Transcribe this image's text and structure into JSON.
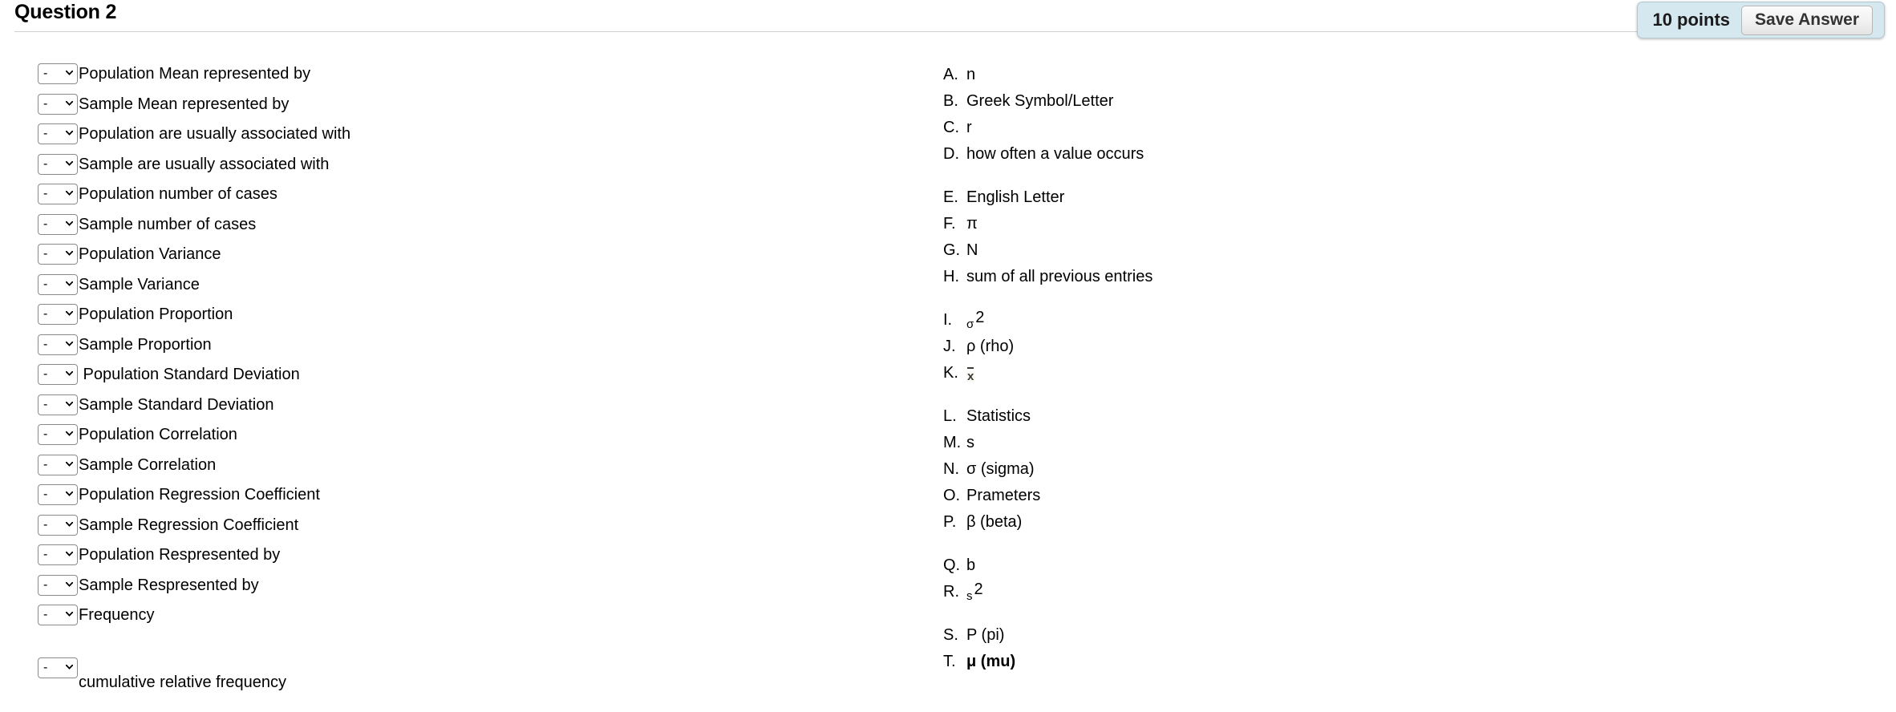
{
  "header": {
    "title": "Question 2",
    "points_label": "10 points",
    "save_label": "Save Answer"
  },
  "select": {
    "current_value": "-",
    "options": [
      "-",
      "A",
      "B",
      "C",
      "D",
      "E",
      "F",
      "G",
      "H",
      "I",
      "J",
      "K",
      "L",
      "M",
      "N",
      "O",
      "P",
      "Q",
      "R",
      "S",
      "T"
    ]
  },
  "prompts": [
    {
      "label": "Population Mean represented by"
    },
    {
      "label": "Sample Mean represented by"
    },
    {
      "label": "Population are usually associated with"
    },
    {
      "label": "Sample are usually associated with"
    },
    {
      "label": "Population number of cases"
    },
    {
      "label": "Sample number of cases"
    },
    {
      "label": "Population Variance"
    },
    {
      "label": "Sample Variance"
    },
    {
      "label": "Population Proportion"
    },
    {
      "label": "Sample Proportion"
    },
    {
      "label": " Population Standard Deviation"
    },
    {
      "label": "Sample Standard Deviation"
    },
    {
      "label": "Population Correlation"
    },
    {
      "label": "Sample Correlation"
    },
    {
      "label": "Population Regression Coefficient"
    },
    {
      "label": "Sample Regression Coefficient"
    },
    {
      "label": "Population Respresented by"
    },
    {
      "label": "Sample Respresented by"
    },
    {
      "label": "Frequency"
    }
  ],
  "prompt_last": {
    "label": "cumulative relative frequency"
  },
  "options": [
    {
      "letter": "A.",
      "text": "n"
    },
    {
      "letter": "B.",
      "text": "Greek Symbol/Letter"
    },
    {
      "letter": "C.",
      "text": "r"
    },
    {
      "letter": "D.",
      "text": "how often a value occurs"
    },
    {
      "letter": "E.",
      "text": "English Letter"
    },
    {
      "letter": "F.",
      "text": "π"
    },
    {
      "letter": "G.",
      "text": "N"
    },
    {
      "letter": "H.",
      "text": "sum of all previous entries"
    },
    {
      "letter": "I.",
      "text": "σ 2",
      "base": "σ",
      "exponent": "2"
    },
    {
      "letter": "J.",
      "text": "ρ (rho)"
    },
    {
      "letter": "K.",
      "text": "x̄"
    },
    {
      "letter": "L.",
      "text": "Statistics"
    },
    {
      "letter": "M.",
      "text": "s"
    },
    {
      "letter": "N.",
      "text": "σ (sigma)"
    },
    {
      "letter": "O.",
      "text": "Prameters"
    },
    {
      "letter": "P.",
      "text": "β (beta)"
    },
    {
      "letter": "Q.",
      "text": "b"
    },
    {
      "letter": "R.",
      "text": "s 2",
      "base": "s",
      "exponent": "2"
    },
    {
      "letter": "S.",
      "text": "P (pi)"
    },
    {
      "letter": "T.",
      "text": "μ (mu)"
    }
  ],
  "colors": {
    "badge_background": "#d6e8ef",
    "badge_border": "#b4c8cf",
    "rule": "#d0d0d0",
    "select_border": "#8a8a8a",
    "text": "#000000"
  }
}
